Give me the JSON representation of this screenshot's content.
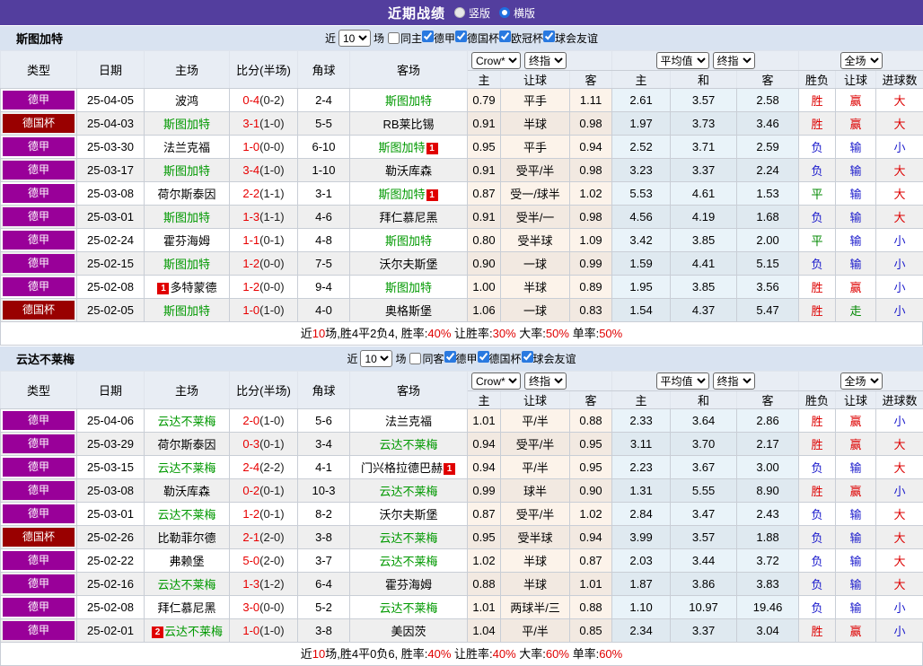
{
  "topbar": {
    "title": "近期战绩",
    "radios": [
      {
        "label": "竖版",
        "checked": false
      },
      {
        "label": "横版",
        "checked": true
      }
    ]
  },
  "table_header": {
    "left_cols": [
      "类型",
      "日期",
      "主场",
      "比分(半场)",
      "角球",
      "客场"
    ],
    "sub_cols": [
      "主",
      "让球",
      "客",
      "主",
      "和",
      "客",
      "胜负",
      "让球",
      "进球数"
    ],
    "dropdowns": {
      "crow": "Crow*",
      "final1": "终指",
      "avg": "平均值",
      "final2": "终指",
      "full": "全场"
    }
  },
  "colors": {
    "league": {
      "德甲": "#990099",
      "德国杯": "#990000"
    },
    "result": {
      "r": "#dd0000",
      "g": "#008800",
      "b": "#1a1acc"
    }
  },
  "sections": [
    {
      "team": "斯图加特",
      "filter": {
        "near": "近",
        "count": "10",
        "games": "场",
        "same_label": "同主",
        "same_checked": false,
        "leagues": [
          {
            "label": "德甲",
            "checked": true
          },
          {
            "label": "德国杯",
            "checked": true
          },
          {
            "label": "欧冠杯",
            "checked": true
          },
          {
            "label": "球会友谊",
            "checked": true
          }
        ]
      },
      "rows": [
        {
          "league": "德甲",
          "date": "25-04-05",
          "home": {
            "name": "波鸿"
          },
          "score": "0-4",
          "half": "(0-2)",
          "corner": "2-4",
          "away": {
            "name": "斯图加特",
            "self": true
          },
          "odds": [
            "0.79",
            "平手",
            "1.11",
            "2.61",
            "3.57",
            "2.58"
          ],
          "results": [
            [
              "胜",
              "r"
            ],
            [
              "赢",
              "r"
            ],
            [
              "大",
              "r"
            ]
          ]
        },
        {
          "league": "德国杯",
          "date": "25-04-03",
          "home": {
            "name": "斯图加特",
            "self": true
          },
          "score": "3-1",
          "half": "(1-0)",
          "corner": "5-5",
          "away": {
            "name": "RB莱比锡"
          },
          "odds": [
            "0.91",
            "半球",
            "0.98",
            "1.97",
            "3.73",
            "3.46"
          ],
          "results": [
            [
              "胜",
              "r"
            ],
            [
              "赢",
              "r"
            ],
            [
              "大",
              "r"
            ]
          ]
        },
        {
          "league": "德甲",
          "date": "25-03-30",
          "home": {
            "name": "法兰克福"
          },
          "score": "1-0",
          "half": "(0-0)",
          "corner": "6-10",
          "away": {
            "name": "斯图加特",
            "self": true,
            "badge": "1",
            "badge_pos": "after"
          },
          "odds": [
            "0.95",
            "平手",
            "0.94",
            "2.52",
            "3.71",
            "2.59"
          ],
          "results": [
            [
              "负",
              "b"
            ],
            [
              "输",
              "b"
            ],
            [
              "小",
              "b"
            ]
          ]
        },
        {
          "league": "德甲",
          "date": "25-03-17",
          "home": {
            "name": "斯图加特",
            "self": true
          },
          "score": "3-4",
          "half": "(1-0)",
          "corner": "1-10",
          "away": {
            "name": "勒沃库森"
          },
          "odds": [
            "0.91",
            "受平/半",
            "0.98",
            "3.23",
            "3.37",
            "2.24"
          ],
          "results": [
            [
              "负",
              "b"
            ],
            [
              "输",
              "b"
            ],
            [
              "大",
              "r"
            ]
          ]
        },
        {
          "league": "德甲",
          "date": "25-03-08",
          "home": {
            "name": "荷尔斯泰因"
          },
          "score": "2-2",
          "half": "(1-1)",
          "corner": "3-1",
          "away": {
            "name": "斯图加特",
            "self": true,
            "badge": "1",
            "badge_pos": "after"
          },
          "odds": [
            "0.87",
            "受一/球半",
            "1.02",
            "5.53",
            "4.61",
            "1.53"
          ],
          "results": [
            [
              "平",
              "g"
            ],
            [
              "输",
              "b"
            ],
            [
              "大",
              "r"
            ]
          ]
        },
        {
          "league": "德甲",
          "date": "25-03-01",
          "home": {
            "name": "斯图加特",
            "self": true
          },
          "score": "1-3",
          "half": "(1-1)",
          "corner": "4-6",
          "away": {
            "name": "拜仁慕尼黑"
          },
          "odds": [
            "0.91",
            "受半/一",
            "0.98",
            "4.56",
            "4.19",
            "1.68"
          ],
          "results": [
            [
              "负",
              "b"
            ],
            [
              "输",
              "b"
            ],
            [
              "大",
              "r"
            ]
          ]
        },
        {
          "league": "德甲",
          "date": "25-02-24",
          "home": {
            "name": "霍芬海姆"
          },
          "score": "1-1",
          "half": "(0-1)",
          "corner": "4-8",
          "away": {
            "name": "斯图加特",
            "self": true
          },
          "odds": [
            "0.80",
            "受半球",
            "1.09",
            "3.42",
            "3.85",
            "2.00"
          ],
          "results": [
            [
              "平",
              "g"
            ],
            [
              "输",
              "b"
            ],
            [
              "小",
              "b"
            ]
          ]
        },
        {
          "league": "德甲",
          "date": "25-02-15",
          "home": {
            "name": "斯图加特",
            "self": true
          },
          "score": "1-2",
          "half": "(0-0)",
          "corner": "7-5",
          "away": {
            "name": "沃尔夫斯堡"
          },
          "odds": [
            "0.90",
            "一球",
            "0.99",
            "1.59",
            "4.41",
            "5.15"
          ],
          "results": [
            [
              "负",
              "b"
            ],
            [
              "输",
              "b"
            ],
            [
              "小",
              "b"
            ]
          ]
        },
        {
          "league": "德甲",
          "date": "25-02-08",
          "home": {
            "name": "多特蒙德",
            "badge": "1",
            "badge_pos": "before"
          },
          "score": "1-2",
          "half": "(0-0)",
          "corner": "9-4",
          "away": {
            "name": "斯图加特",
            "self": true
          },
          "odds": [
            "1.00",
            "半球",
            "0.89",
            "1.95",
            "3.85",
            "3.56"
          ],
          "results": [
            [
              "胜",
              "r"
            ],
            [
              "赢",
              "r"
            ],
            [
              "小",
              "b"
            ]
          ]
        },
        {
          "league": "德国杯",
          "date": "25-02-05",
          "home": {
            "name": "斯图加特",
            "self": true
          },
          "score": "1-0",
          "half": "(1-0)",
          "corner": "4-0",
          "away": {
            "name": "奥格斯堡"
          },
          "odds": [
            "1.06",
            "一球",
            "0.83",
            "1.54",
            "4.37",
            "5.47"
          ],
          "results": [
            [
              "胜",
              "r"
            ],
            [
              "走",
              "g"
            ],
            [
              "小",
              "b"
            ]
          ]
        }
      ],
      "summary": [
        {
          "text": "近",
          "hl": false
        },
        {
          "text": "10",
          "hl": true
        },
        {
          "text": "场,胜4平2负4, 胜率:",
          "hl": false
        },
        {
          "text": "40%",
          "hl": true
        },
        {
          "text": " 让胜率:",
          "hl": false
        },
        {
          "text": "30%",
          "hl": true
        },
        {
          "text": " 大率:",
          "hl": false
        },
        {
          "text": "50%",
          "hl": true
        },
        {
          "text": " 单率:",
          "hl": false
        },
        {
          "text": "50%",
          "hl": true
        }
      ]
    },
    {
      "team": "云达不莱梅",
      "filter": {
        "near": "近",
        "count": "10",
        "games": "场",
        "same_label": "同客",
        "same_checked": false,
        "leagues": [
          {
            "label": "德甲",
            "checked": true
          },
          {
            "label": "德国杯",
            "checked": true
          },
          {
            "label": "球会友谊",
            "checked": true
          }
        ]
      },
      "rows": [
        {
          "league": "德甲",
          "date": "25-04-06",
          "home": {
            "name": "云达不莱梅",
            "self": true
          },
          "score": "2-0",
          "half": "(1-0)",
          "corner": "5-6",
          "away": {
            "name": "法兰克福"
          },
          "odds": [
            "1.01",
            "平/半",
            "0.88",
            "2.33",
            "3.64",
            "2.86"
          ],
          "results": [
            [
              "胜",
              "r"
            ],
            [
              "赢",
              "r"
            ],
            [
              "小",
              "b"
            ]
          ]
        },
        {
          "league": "德甲",
          "date": "25-03-29",
          "home": {
            "name": "荷尔斯泰因"
          },
          "score": "0-3",
          "half": "(0-1)",
          "corner": "3-4",
          "away": {
            "name": "云达不莱梅",
            "self": true
          },
          "odds": [
            "0.94",
            "受平/半",
            "0.95",
            "3.11",
            "3.70",
            "2.17"
          ],
          "results": [
            [
              "胜",
              "r"
            ],
            [
              "赢",
              "r"
            ],
            [
              "大",
              "r"
            ]
          ]
        },
        {
          "league": "德甲",
          "date": "25-03-15",
          "home": {
            "name": "云达不莱梅",
            "self": true
          },
          "score": "2-4",
          "half": "(2-2)",
          "corner": "4-1",
          "away": {
            "name": "门兴格拉德巴赫",
            "badge": "1",
            "badge_pos": "after"
          },
          "odds": [
            "0.94",
            "平/半",
            "0.95",
            "2.23",
            "3.67",
            "3.00"
          ],
          "results": [
            [
              "负",
              "b"
            ],
            [
              "输",
              "b"
            ],
            [
              "大",
              "r"
            ]
          ]
        },
        {
          "league": "德甲",
          "date": "25-03-08",
          "home": {
            "name": "勒沃库森"
          },
          "score": "0-2",
          "half": "(0-1)",
          "corner": "10-3",
          "away": {
            "name": "云达不莱梅",
            "self": true
          },
          "odds": [
            "0.99",
            "球半",
            "0.90",
            "1.31",
            "5.55",
            "8.90"
          ],
          "results": [
            [
              "胜",
              "r"
            ],
            [
              "赢",
              "r"
            ],
            [
              "小",
              "b"
            ]
          ]
        },
        {
          "league": "德甲",
          "date": "25-03-01",
          "home": {
            "name": "云达不莱梅",
            "self": true
          },
          "score": "1-2",
          "half": "(0-1)",
          "corner": "8-2",
          "away": {
            "name": "沃尔夫斯堡"
          },
          "odds": [
            "0.87",
            "受平/半",
            "1.02",
            "2.84",
            "3.47",
            "2.43"
          ],
          "results": [
            [
              "负",
              "b"
            ],
            [
              "输",
              "b"
            ],
            [
              "大",
              "r"
            ]
          ]
        },
        {
          "league": "德国杯",
          "date": "25-02-26",
          "home": {
            "name": "比勒菲尔德"
          },
          "score": "2-1",
          "half": "(2-0)",
          "corner": "3-8",
          "away": {
            "name": "云达不莱梅",
            "self": true
          },
          "odds": [
            "0.95",
            "受半球",
            "0.94",
            "3.99",
            "3.57",
            "1.88"
          ],
          "results": [
            [
              "负",
              "b"
            ],
            [
              "输",
              "b"
            ],
            [
              "大",
              "r"
            ]
          ]
        },
        {
          "league": "德甲",
          "date": "25-02-22",
          "home": {
            "name": "弗赖堡"
          },
          "score": "5-0",
          "half": "(2-0)",
          "corner": "3-7",
          "away": {
            "name": "云达不莱梅",
            "self": true
          },
          "odds": [
            "1.02",
            "半球",
            "0.87",
            "2.03",
            "3.44",
            "3.72"
          ],
          "results": [
            [
              "负",
              "b"
            ],
            [
              "输",
              "b"
            ],
            [
              "大",
              "r"
            ]
          ]
        },
        {
          "league": "德甲",
          "date": "25-02-16",
          "home": {
            "name": "云达不莱梅",
            "self": true
          },
          "score": "1-3",
          "half": "(1-2)",
          "corner": "6-4",
          "away": {
            "name": "霍芬海姆"
          },
          "odds": [
            "0.88",
            "半球",
            "1.01",
            "1.87",
            "3.86",
            "3.83"
          ],
          "results": [
            [
              "负",
              "b"
            ],
            [
              "输",
              "b"
            ],
            [
              "大",
              "r"
            ]
          ]
        },
        {
          "league": "德甲",
          "date": "25-02-08",
          "home": {
            "name": "拜仁慕尼黑"
          },
          "score": "3-0",
          "half": "(0-0)",
          "corner": "5-2",
          "away": {
            "name": "云达不莱梅",
            "self": true
          },
          "odds": [
            "1.01",
            "两球半/三",
            "0.88",
            "1.10",
            "10.97",
            "19.46"
          ],
          "results": [
            [
              "负",
              "b"
            ],
            [
              "输",
              "b"
            ],
            [
              "小",
              "b"
            ]
          ]
        },
        {
          "league": "德甲",
          "date": "25-02-01",
          "home": {
            "name": "云达不莱梅",
            "self": true,
            "badge": "2",
            "badge_pos": "before"
          },
          "score": "1-0",
          "half": "(1-0)",
          "corner": "3-8",
          "away": {
            "name": "美因茨"
          },
          "odds": [
            "1.04",
            "平/半",
            "0.85",
            "2.34",
            "3.37",
            "3.04"
          ],
          "results": [
            [
              "胜",
              "r"
            ],
            [
              "赢",
              "r"
            ],
            [
              "小",
              "b"
            ]
          ]
        }
      ],
      "summary": [
        {
          "text": "近",
          "hl": false
        },
        {
          "text": "10",
          "hl": true
        },
        {
          "text": "场,胜4平0负6, 胜率:",
          "hl": false
        },
        {
          "text": "40%",
          "hl": true
        },
        {
          "text": " 让胜率:",
          "hl": false
        },
        {
          "text": "40%",
          "hl": true
        },
        {
          "text": " 大率:",
          "hl": false
        },
        {
          "text": "60%",
          "hl": true
        },
        {
          "text": " 单率:",
          "hl": false
        },
        {
          "text": "60%",
          "hl": true
        }
      ]
    }
  ]
}
